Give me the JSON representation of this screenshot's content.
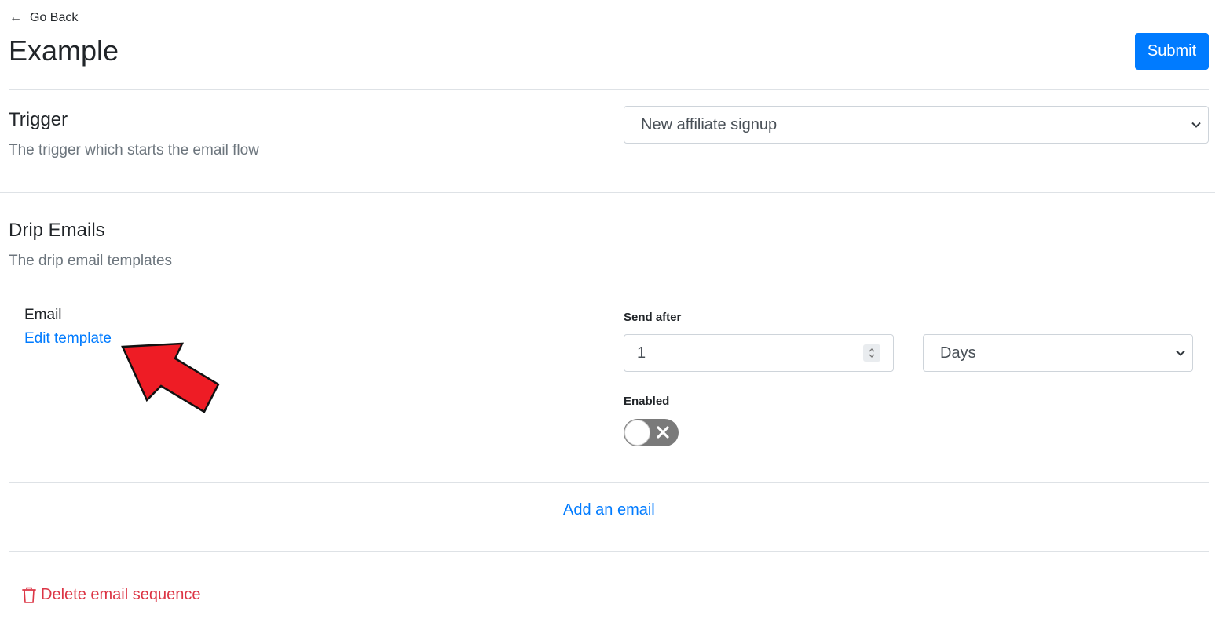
{
  "header": {
    "go_back_label": "Go Back",
    "title": "Example",
    "submit_label": "Submit"
  },
  "trigger": {
    "title": "Trigger",
    "subtitle": "The trigger which starts the email flow",
    "selected": "New affiliate signup"
  },
  "drip": {
    "title": "Drip Emails",
    "subtitle": "The drip email templates",
    "email": {
      "label": "Email",
      "edit_link": "Edit template",
      "send_after_label": "Send after",
      "send_after_value": "1",
      "unit_selected": "Days",
      "enabled_label": "Enabled",
      "enabled": false
    },
    "add_email_label": "Add an email"
  },
  "footer": {
    "delete_label": "Delete email sequence"
  },
  "colors": {
    "primary": "#007bff",
    "danger": "#dc3545",
    "muted": "#6c757d",
    "annotation_arrow": "#ee1c25"
  },
  "icons": [
    "arrow-left-icon",
    "chevron-down-icon",
    "spinner-arrows-icon",
    "close-icon",
    "trash-icon",
    "annotation-arrow-icon"
  ]
}
